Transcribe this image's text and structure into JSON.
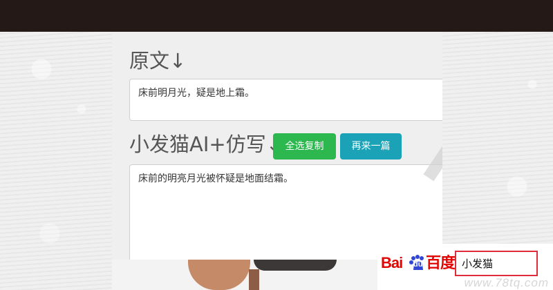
{
  "page": {
    "background_color": "#ededed",
    "topbar_color": "#241917"
  },
  "sections": {
    "original": {
      "title": "原文↓",
      "text": "床前明月光，疑是地上霜。"
    },
    "ai": {
      "title": "小发猫AI+仿写↓",
      "text": "床前的明亮月光被怀疑是地面结霜。",
      "buttons": [
        {
          "label": "全选复制",
          "color": "#2db84f"
        },
        {
          "label": "再来一篇",
          "color": "#1ba2b7"
        }
      ]
    }
  },
  "search": {
    "logo_parts": {
      "left": "Bai",
      "middle": "du",
      "right": "百度"
    },
    "logo_colors": {
      "red": "#e10602",
      "blue": "#2319dc",
      "paw": "#3146d4"
    },
    "value": "小发猫",
    "border_color": "#df2a3a"
  },
  "footer": {
    "watermark": "www.78tq.com"
  },
  "icons": {
    "baidu_paw": "baidu-paw-icon"
  }
}
